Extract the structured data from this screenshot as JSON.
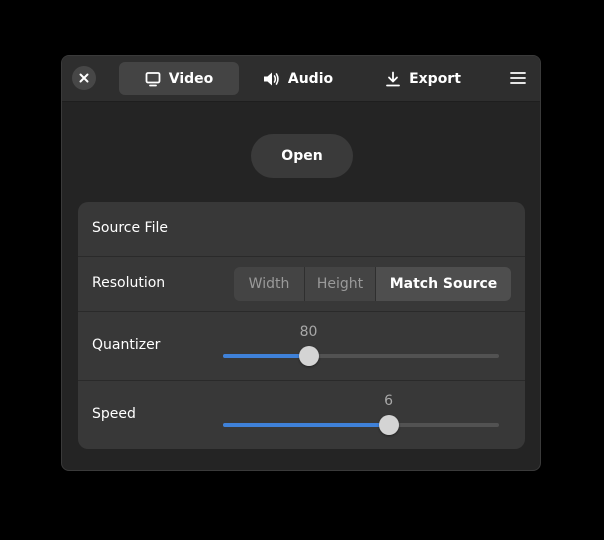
{
  "header": {
    "close_icon": "close-icon",
    "tabs": [
      {
        "label": "Video",
        "icon": "monitor-icon",
        "active": true
      },
      {
        "label": "Audio",
        "icon": "speaker-icon",
        "active": false
      },
      {
        "label": "Export",
        "icon": "download-icon",
        "active": false
      }
    ],
    "menu_icon": "hamburger-menu-icon"
  },
  "open_button": {
    "label": "Open"
  },
  "settings": {
    "source_file": {
      "label": "Source File"
    },
    "resolution": {
      "label": "Resolution",
      "options": [
        "Width",
        "Height",
        "Match Source"
      ],
      "selected": "Match Source"
    },
    "quantizer": {
      "label": "Quantizer",
      "value": "80",
      "fraction": 0.31
    },
    "speed": {
      "label": "Speed",
      "value": "6",
      "fraction": 0.6
    }
  },
  "colors": {
    "accent": "#3f81d8",
    "window_bg": "#242424",
    "card_bg": "#383838"
  }
}
